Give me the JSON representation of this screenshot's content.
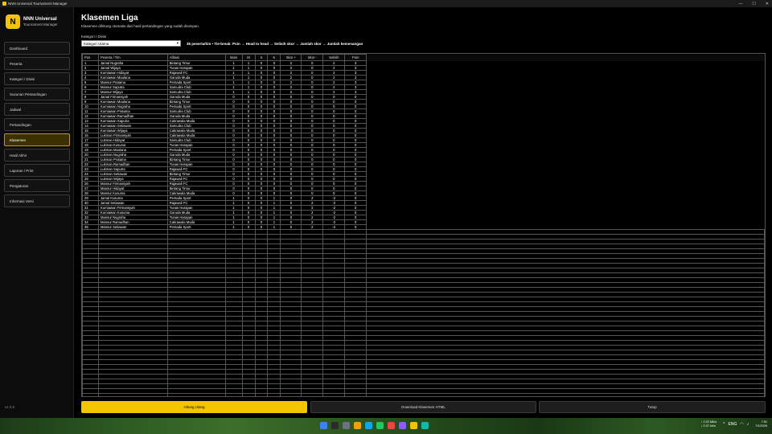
{
  "window": {
    "title": "NNN Universal Tournament Manager"
  },
  "brand": {
    "logo_letter": "N",
    "name": "NNN Universal",
    "subtitle": "Tournament Manager"
  },
  "nav": [
    {
      "label": "Dashboard"
    },
    {
      "label": "Peserta"
    },
    {
      "label": "Kategori / Divisi"
    },
    {
      "label": "Susunan Pertandingan"
    },
    {
      "label": "Jadwal"
    },
    {
      "label": "Pertandingan"
    },
    {
      "label": "Klasemen",
      "active": true
    },
    {
      "label": "Hasil Akhir"
    },
    {
      "label": "Laporan / Print"
    },
    {
      "label": "Pengaturan"
    },
    {
      "label": "Informasi Versi"
    }
  ],
  "version": "v1.0.0",
  "page": {
    "title": "Klasemen Liga",
    "subtitle": "Klasemen dihitung otomatis dari hasil pertandingan yang sudah disimpan.",
    "category_label": "Kategori / Divisi",
    "category_value": "Kategori Utama",
    "rules": "35 peserta/tim • Tie-break: Poin → Head to head → Selisih skor → Jumlah skor → Jumlah kemenangan"
  },
  "table": {
    "headers": [
      "Pos",
      "Peserta / Tim",
      "Afiliasi",
      "Main",
      "M",
      "S",
      "K",
      "Skor +",
      "Skor -",
      "Selisih",
      "Poin"
    ],
    "rows": [
      [
        "1",
        "Jamal Nugraha",
        "Bintang Timur",
        "1",
        "1",
        "0",
        "0",
        "2",
        "0",
        "2",
        "3"
      ],
      [
        "2",
        "Jamal Wijaya",
        "Tunas Harapan",
        "1",
        "1",
        "0",
        "0",
        "2",
        "0",
        "2",
        "3"
      ],
      [
        "3",
        "Kurniawan Hidayat",
        "Rajawali FC",
        "1",
        "1",
        "0",
        "0",
        "2",
        "0",
        "2",
        "3"
      ],
      [
        "4",
        "Kurniawan Maulana",
        "Garuda Muda",
        "1",
        "1",
        "0",
        "0",
        "2",
        "0",
        "2",
        "3"
      ],
      [
        "5",
        "Mansur Pratama",
        "Persada Sport",
        "1",
        "1",
        "0",
        "0",
        "2",
        "0",
        "2",
        "3"
      ],
      [
        "6",
        "Mansur Saputra",
        "Samudra Club",
        "1",
        "1",
        "0",
        "0",
        "2",
        "0",
        "2",
        "3"
      ],
      [
        "7",
        "Mansur Wijaya",
        "Samudra Club",
        "1",
        "1",
        "0",
        "0",
        "2",
        "0",
        "2",
        "3"
      ],
      [
        "8",
        "Jamal Firmansyah",
        "Garuda Muda",
        "0",
        "0",
        "0",
        "0",
        "0",
        "0",
        "0",
        "0"
      ],
      [
        "9",
        "Kurniawan Maulana",
        "Bintang Timur",
        "0",
        "0",
        "0",
        "0",
        "0",
        "0",
        "0",
        "0"
      ],
      [
        "10",
        "Kurniawan Nugraha",
        "Persada Sport",
        "0",
        "0",
        "0",
        "0",
        "0",
        "0",
        "0",
        "0"
      ],
      [
        "11",
        "Kurniawan Pratama",
        "Samudra Club",
        "0",
        "0",
        "0",
        "0",
        "0",
        "0",
        "0",
        "0"
      ],
      [
        "12",
        "Kurniawan Ramadhan",
        "Garuda Muda",
        "0",
        "0",
        "0",
        "0",
        "0",
        "0",
        "0",
        "0"
      ],
      [
        "13",
        "Kurniawan Saputra",
        "Cakrawala Muda",
        "0",
        "0",
        "0",
        "0",
        "0",
        "0",
        "0",
        "0"
      ],
      [
        "14",
        "Kurniawan Setiawan",
        "Samudra Club",
        "0",
        "0",
        "0",
        "0",
        "0",
        "0",
        "0",
        "0"
      ],
      [
        "15",
        "Kurniawan Wijaya",
        "Cakrawala Muda",
        "0",
        "0",
        "0",
        "0",
        "0",
        "0",
        "0",
        "0"
      ],
      [
        "16",
        "Lukman Firmansyah",
        "Cakrawala Muda",
        "0",
        "0",
        "0",
        "0",
        "0",
        "0",
        "0",
        "0"
      ],
      [
        "17",
        "Lukman Hidayat",
        "Samudra Club",
        "0",
        "0",
        "0",
        "0",
        "0",
        "0",
        "0",
        "0"
      ],
      [
        "18",
        "Lukman Kusuma",
        "Tunas Harapan",
        "0",
        "0",
        "0",
        "0",
        "0",
        "0",
        "0",
        "0"
      ],
      [
        "19",
        "Lukman Maulana",
        "Persada Sport",
        "0",
        "0",
        "0",
        "0",
        "0",
        "0",
        "0",
        "0"
      ],
      [
        "20",
        "Lukman Nugraha",
        "Garuda Muda",
        "0",
        "0",
        "0",
        "0",
        "0",
        "0",
        "0",
        "0"
      ],
      [
        "21",
        "Lukman Pratama",
        "Bintang Timur",
        "0",
        "0",
        "0",
        "0",
        "0",
        "0",
        "0",
        "0"
      ],
      [
        "22",
        "Lukman Ramadhan",
        "Tunas Harapan",
        "0",
        "0",
        "0",
        "0",
        "0",
        "0",
        "0",
        "0"
      ],
      [
        "23",
        "Lukman Saputra",
        "Rajawali FC",
        "0",
        "0",
        "0",
        "0",
        "0",
        "0",
        "0",
        "0"
      ],
      [
        "24",
        "Lukman Setiawan",
        "Bintang Timur",
        "0",
        "0",
        "0",
        "0",
        "0",
        "0",
        "0",
        "0"
      ],
      [
        "25",
        "Lukman Wijaya",
        "Rajawali FC",
        "0",
        "0",
        "0",
        "0",
        "0",
        "0",
        "0",
        "0"
      ],
      [
        "26",
        "Mansur Firmansyah",
        "Rajawali FC",
        "0",
        "0",
        "0",
        "0",
        "0",
        "0",
        "0",
        "0"
      ],
      [
        "27",
        "Mansur Hidayat",
        "Bintang Timur",
        "0",
        "0",
        "0",
        "0",
        "0",
        "0",
        "0",
        "0"
      ],
      [
        "28",
        "Mansur Kusuma",
        "Cakrawala Muda",
        "0",
        "0",
        "0",
        "0",
        "0",
        "0",
        "0",
        "0"
      ],
      [
        "29",
        "Jamal Kusuma",
        "Persada Sport",
        "1",
        "0",
        "0",
        "1",
        "0",
        "2",
        "-2",
        "0"
      ],
      [
        "30",
        "Jamal Setiawan",
        "Rajawali FC",
        "1",
        "0",
        "0",
        "1",
        "0",
        "2",
        "-2",
        "0"
      ],
      [
        "31",
        "Kurniawan Firmansyah",
        "Tunas Harapan",
        "1",
        "0",
        "0",
        "1",
        "0",
        "2",
        "-2",
        "0"
      ],
      [
        "32",
        "Kurniawan Kusuma",
        "Garuda Muda",
        "1",
        "0",
        "0",
        "1",
        "0",
        "2",
        "-2",
        "0"
      ],
      [
        "33",
        "Mansur Nugraha",
        "Tunas Harapan",
        "1",
        "0",
        "0",
        "1",
        "0",
        "2",
        "-2",
        "0"
      ],
      [
        "34",
        "Mansur Ramadhan",
        "Cakrawala Muda",
        "1",
        "0",
        "0",
        "1",
        "0",
        "2",
        "-2",
        "0"
      ],
      [
        "35",
        "Mansur Setiawan",
        "Persada Sport",
        "1",
        "0",
        "0",
        "1",
        "0",
        "2",
        "-2",
        "0"
      ]
    ]
  },
  "buttons": {
    "recalculate": "Hitung Ulang",
    "download": "Download Klasemen HTML",
    "close": "Tutup"
  },
  "taskbar": {
    "net_up": "↑ 2.22 Mb/s",
    "net_down": "↓ 0.37 kb/s",
    "lang": "ENG",
    "time": "7:51",
    "date": "7/1/2025"
  },
  "colors": {
    "accent": "#f2c500",
    "background": "#000000",
    "sidebar": "#0c0c0c"
  }
}
